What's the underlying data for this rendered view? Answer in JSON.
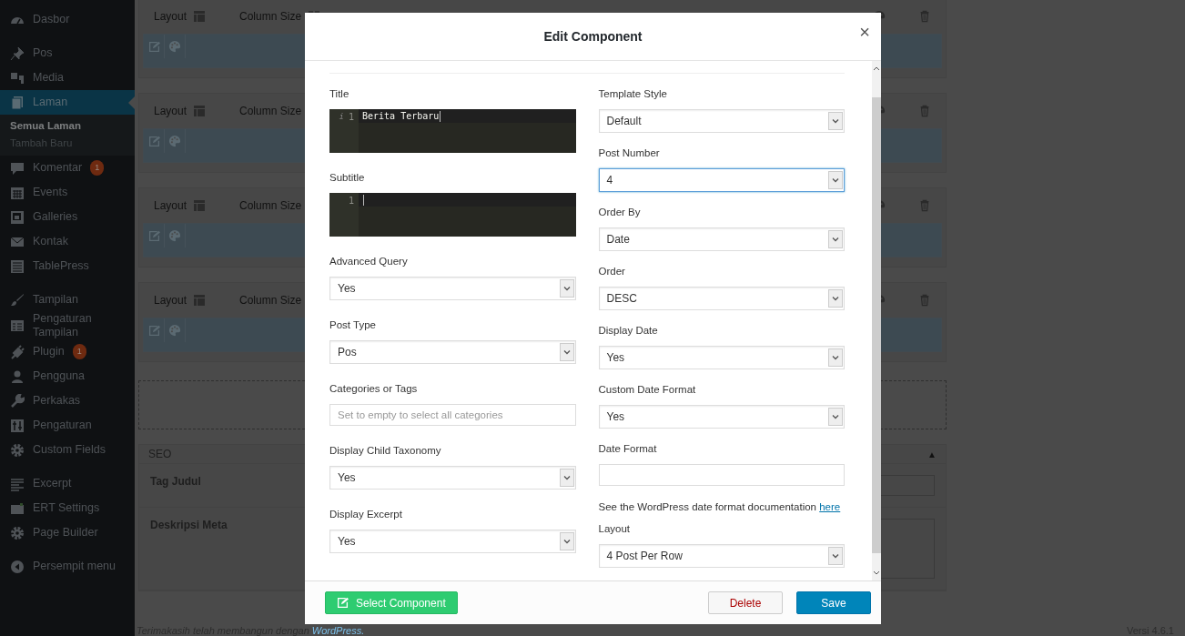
{
  "sidebar": {
    "groups": [
      [
        {
          "label": "Dasbor",
          "selected": false
        }
      ],
      [
        {
          "label": "Pos",
          "selected": false
        },
        {
          "label": "Media",
          "selected": false
        },
        {
          "label": "Laman",
          "selected": true,
          "children": [
            {
              "label": "Semua Laman",
              "selected": true
            },
            {
              "label": "Tambah Baru",
              "selected": false
            }
          ]
        },
        {
          "label": "Komentar",
          "badge": "1",
          "selected": false
        },
        {
          "label": "Events",
          "selected": false
        },
        {
          "label": "Galleries",
          "selected": false
        },
        {
          "label": "Kontak",
          "selected": false
        },
        {
          "label": "TablePress",
          "selected": false
        }
      ],
      [
        {
          "label": "Tampilan",
          "selected": false
        },
        {
          "label": "Pengaturan Tampilan",
          "selected": false
        },
        {
          "label": "Plugin",
          "badge": "1",
          "selected": false
        },
        {
          "label": "Pengguna",
          "selected": false
        },
        {
          "label": "Perkakas",
          "selected": false
        },
        {
          "label": "Pengaturan",
          "selected": false
        },
        {
          "label": "Custom Fields",
          "selected": false
        }
      ],
      [
        {
          "label": "Excerpt",
          "selected": false
        },
        {
          "label": "ERT Settings",
          "selected": false
        },
        {
          "label": "Page Builder",
          "selected": false
        }
      ]
    ],
    "collapse": "Persempit menu"
  },
  "builder": {
    "rows": [
      {
        "layout_label": "Layout",
        "column_label": "Column Size"
      },
      {
        "layout_label": "Layout",
        "column_label": "Column Size"
      },
      {
        "layout_label": "Layout",
        "column_label": "Column Size"
      },
      {
        "layout_label": "Layout",
        "column_label": "Column Size"
      }
    ]
  },
  "seo": {
    "title": "SEO",
    "toggle": "▲",
    "fields": [
      {
        "label": "Tag Judul",
        "kind": "input"
      },
      {
        "label": "Deskripsi Meta",
        "kind": "textarea"
      }
    ]
  },
  "footer": {
    "text": "Terimakasih telah membangun dengan",
    "link": "WordPress.",
    "version": "Versi 4.6.1"
  },
  "modal": {
    "title": "Edit Component",
    "close": "×",
    "left": [
      {
        "kind": "code",
        "label": "Title",
        "marker": "i",
        "line": "1",
        "value": "Berita Terbaru"
      },
      {
        "kind": "code",
        "label": "Subtitle",
        "line": "1"
      },
      {
        "kind": "select",
        "label": "Advanced Query",
        "value": "Yes",
        "focused": false
      },
      {
        "kind": "select",
        "label": "Post Type",
        "value": "Pos",
        "focused": false
      },
      {
        "kind": "text",
        "label": "Categories or Tags",
        "placeholder": "Set to empty to select all categories"
      },
      {
        "kind": "select",
        "label": "Display Child Taxonomy",
        "value": "Yes",
        "focused": false
      },
      {
        "kind": "select",
        "label": "Display Excerpt",
        "value": "Yes",
        "focused": false
      }
    ],
    "right": [
      {
        "kind": "select",
        "label": "Template Style",
        "value": "Default",
        "focused": false
      },
      {
        "kind": "select",
        "label": "Post Number",
        "value": "4",
        "focused": true
      },
      {
        "kind": "select",
        "label": "Order By",
        "value": "Date",
        "focused": false
      },
      {
        "kind": "select",
        "label": "Order",
        "value": "DESC",
        "focused": false
      },
      {
        "kind": "select",
        "label": "Display Date",
        "value": "Yes",
        "focused": false
      },
      {
        "kind": "select",
        "label": "Custom Date Format",
        "value": "Yes",
        "focused": false
      },
      {
        "kind": "text",
        "label": "Date Format"
      },
      {
        "kind": "note",
        "text": "See the WordPress date format documentation",
        "link": "here"
      },
      {
        "kind": "select",
        "label": "Layout",
        "value": "4 Post Per Row",
        "focused": false
      }
    ],
    "buttons": {
      "select": "Select Component",
      "delete": "Delete",
      "save": "Save"
    }
  }
}
